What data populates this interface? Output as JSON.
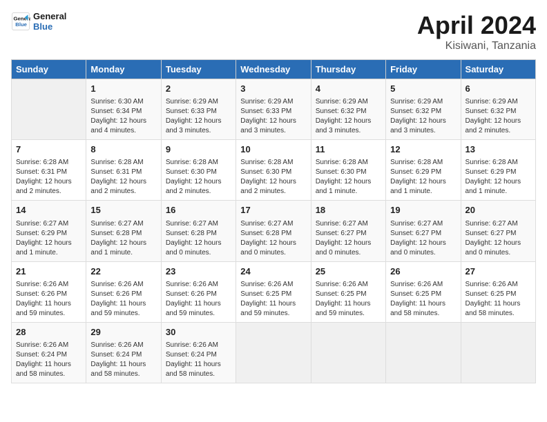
{
  "logo": {
    "line1": "General",
    "line2": "Blue"
  },
  "title": "April 2024",
  "location": "Kisiwani, Tanzania",
  "weekdays": [
    "Sunday",
    "Monday",
    "Tuesday",
    "Wednesday",
    "Thursday",
    "Friday",
    "Saturday"
  ],
  "weeks": [
    [
      {
        "day": "",
        "info": ""
      },
      {
        "day": "1",
        "info": "Sunrise: 6:30 AM\nSunset: 6:34 PM\nDaylight: 12 hours\nand 4 minutes."
      },
      {
        "day": "2",
        "info": "Sunrise: 6:29 AM\nSunset: 6:33 PM\nDaylight: 12 hours\nand 3 minutes."
      },
      {
        "day": "3",
        "info": "Sunrise: 6:29 AM\nSunset: 6:33 PM\nDaylight: 12 hours\nand 3 minutes."
      },
      {
        "day": "4",
        "info": "Sunrise: 6:29 AM\nSunset: 6:32 PM\nDaylight: 12 hours\nand 3 minutes."
      },
      {
        "day": "5",
        "info": "Sunrise: 6:29 AM\nSunset: 6:32 PM\nDaylight: 12 hours\nand 3 minutes."
      },
      {
        "day": "6",
        "info": "Sunrise: 6:29 AM\nSunset: 6:32 PM\nDaylight: 12 hours\nand 2 minutes."
      }
    ],
    [
      {
        "day": "7",
        "info": "Sunrise: 6:28 AM\nSunset: 6:31 PM\nDaylight: 12 hours\nand 2 minutes."
      },
      {
        "day": "8",
        "info": "Sunrise: 6:28 AM\nSunset: 6:31 PM\nDaylight: 12 hours\nand 2 minutes."
      },
      {
        "day": "9",
        "info": "Sunrise: 6:28 AM\nSunset: 6:30 PM\nDaylight: 12 hours\nand 2 minutes."
      },
      {
        "day": "10",
        "info": "Sunrise: 6:28 AM\nSunset: 6:30 PM\nDaylight: 12 hours\nand 2 minutes."
      },
      {
        "day": "11",
        "info": "Sunrise: 6:28 AM\nSunset: 6:30 PM\nDaylight: 12 hours\nand 1 minute."
      },
      {
        "day": "12",
        "info": "Sunrise: 6:28 AM\nSunset: 6:29 PM\nDaylight: 12 hours\nand 1 minute."
      },
      {
        "day": "13",
        "info": "Sunrise: 6:28 AM\nSunset: 6:29 PM\nDaylight: 12 hours\nand 1 minute."
      }
    ],
    [
      {
        "day": "14",
        "info": "Sunrise: 6:27 AM\nSunset: 6:29 PM\nDaylight: 12 hours\nand 1 minute."
      },
      {
        "day": "15",
        "info": "Sunrise: 6:27 AM\nSunset: 6:28 PM\nDaylight: 12 hours\nand 1 minute."
      },
      {
        "day": "16",
        "info": "Sunrise: 6:27 AM\nSunset: 6:28 PM\nDaylight: 12 hours\nand 0 minutes."
      },
      {
        "day": "17",
        "info": "Sunrise: 6:27 AM\nSunset: 6:28 PM\nDaylight: 12 hours\nand 0 minutes."
      },
      {
        "day": "18",
        "info": "Sunrise: 6:27 AM\nSunset: 6:27 PM\nDaylight: 12 hours\nand 0 minutes."
      },
      {
        "day": "19",
        "info": "Sunrise: 6:27 AM\nSunset: 6:27 PM\nDaylight: 12 hours\nand 0 minutes."
      },
      {
        "day": "20",
        "info": "Sunrise: 6:27 AM\nSunset: 6:27 PM\nDaylight: 12 hours\nand 0 minutes."
      }
    ],
    [
      {
        "day": "21",
        "info": "Sunrise: 6:26 AM\nSunset: 6:26 PM\nDaylight: 11 hours\nand 59 minutes."
      },
      {
        "day": "22",
        "info": "Sunrise: 6:26 AM\nSunset: 6:26 PM\nDaylight: 11 hours\nand 59 minutes."
      },
      {
        "day": "23",
        "info": "Sunrise: 6:26 AM\nSunset: 6:26 PM\nDaylight: 11 hours\nand 59 minutes."
      },
      {
        "day": "24",
        "info": "Sunrise: 6:26 AM\nSunset: 6:25 PM\nDaylight: 11 hours\nand 59 minutes."
      },
      {
        "day": "25",
        "info": "Sunrise: 6:26 AM\nSunset: 6:25 PM\nDaylight: 11 hours\nand 59 minutes."
      },
      {
        "day": "26",
        "info": "Sunrise: 6:26 AM\nSunset: 6:25 PM\nDaylight: 11 hours\nand 58 minutes."
      },
      {
        "day": "27",
        "info": "Sunrise: 6:26 AM\nSunset: 6:25 PM\nDaylight: 11 hours\nand 58 minutes."
      }
    ],
    [
      {
        "day": "28",
        "info": "Sunrise: 6:26 AM\nSunset: 6:24 PM\nDaylight: 11 hours\nand 58 minutes."
      },
      {
        "day": "29",
        "info": "Sunrise: 6:26 AM\nSunset: 6:24 PM\nDaylight: 11 hours\nand 58 minutes."
      },
      {
        "day": "30",
        "info": "Sunrise: 6:26 AM\nSunset: 6:24 PM\nDaylight: 11 hours\nand 58 minutes."
      },
      {
        "day": "",
        "info": ""
      },
      {
        "day": "",
        "info": ""
      },
      {
        "day": "",
        "info": ""
      },
      {
        "day": "",
        "info": ""
      }
    ]
  ]
}
